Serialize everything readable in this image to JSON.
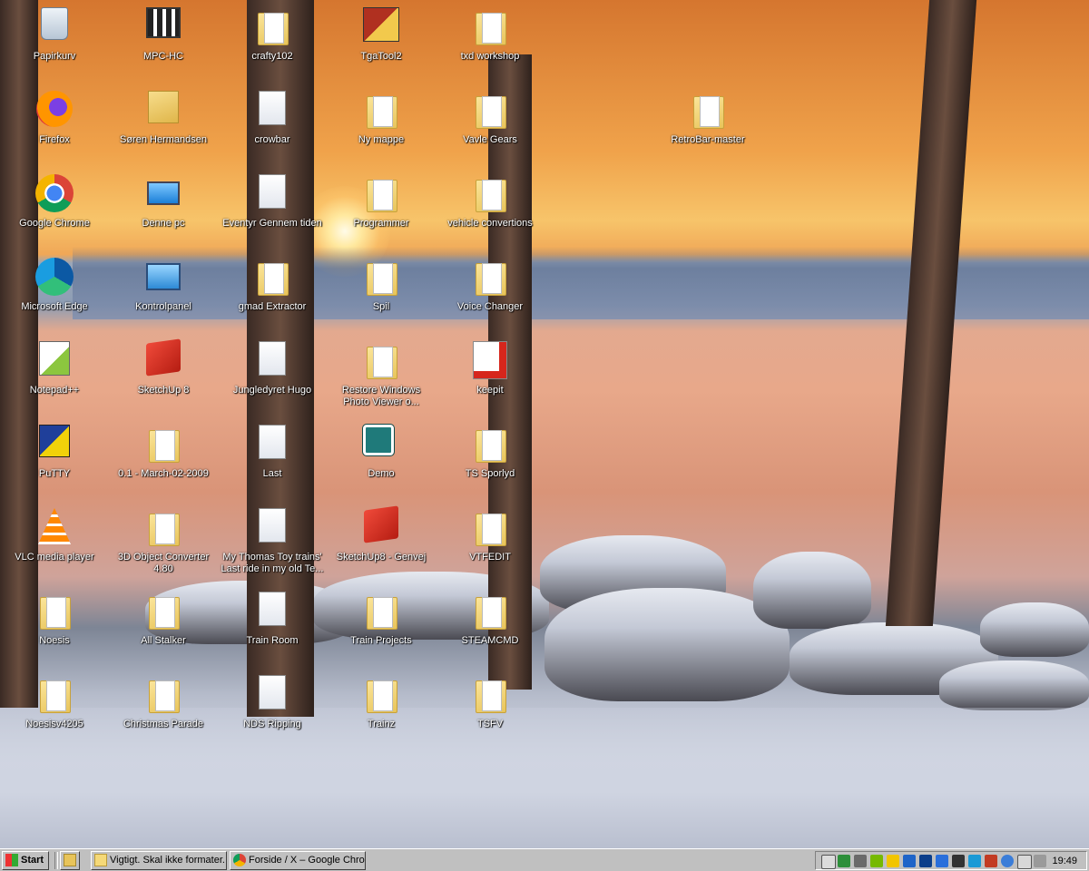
{
  "desktop": {
    "icons": [
      {
        "label": "Papirkurv",
        "icon": "recycle-bin-icon"
      },
      {
        "label": "MPC-HC",
        "icon": "mpc-hc-icon"
      },
      {
        "label": "crafty102",
        "icon": "folder-icon"
      },
      {
        "label": "TgaTool2",
        "icon": "tgatool-icon"
      },
      {
        "label": "txd workshop",
        "icon": "folder-icon"
      },
      {
        "label": "Firefox",
        "icon": "firefox-icon"
      },
      {
        "label": "Søren Hermandsen",
        "icon": "user-folder-icon"
      },
      {
        "label": "crowbar",
        "icon": "shortcut-file-icon"
      },
      {
        "label": "Ny mappe",
        "icon": "folder-icon"
      },
      {
        "label": "Vavle Gears",
        "icon": "folder-icon"
      },
      {
        "label": "RetroBar-master",
        "icon": "folder-icon"
      },
      {
        "label": "Google Chrome",
        "icon": "chrome-icon"
      },
      {
        "label": "Denne pc",
        "icon": "computer-icon"
      },
      {
        "label": "Eventyr Gennem tiden",
        "icon": "shortcut-file-icon"
      },
      {
        "label": "Programmer",
        "icon": "folder-icon"
      },
      {
        "label": "vehicle convertions",
        "icon": "folder-icon"
      },
      {
        "label": "Microsoft Edge",
        "icon": "edge-icon"
      },
      {
        "label": "Kontrolpanel",
        "icon": "control-panel-icon"
      },
      {
        "label": "gmad Extractor",
        "icon": "folder-icon"
      },
      {
        "label": "Spil",
        "icon": "folder-icon"
      },
      {
        "label": "Voice Changer",
        "icon": "folder-icon"
      },
      {
        "label": "Notepad++",
        "icon": "notepadpp-icon"
      },
      {
        "label": "SketchUp 8",
        "icon": "sketchup-icon"
      },
      {
        "label": "Jungledyret Hugo",
        "icon": "shortcut-file-icon"
      },
      {
        "label": "Restore Windows Photo Viewer o...",
        "icon": "folder-icon"
      },
      {
        "label": "keepit",
        "icon": "pdf-icon"
      },
      {
        "label": "PuTTY",
        "icon": "putty-icon"
      },
      {
        "label": "0.1 - March-02-2009",
        "icon": "folder-icon"
      },
      {
        "label": "Last",
        "icon": "shortcut-file-icon"
      },
      {
        "label": "Demo",
        "icon": "cart-app-icon"
      },
      {
        "label": "TS Sporlyd",
        "icon": "folder-icon"
      },
      {
        "label": "VLC media player",
        "icon": "vlc-icon"
      },
      {
        "label": "3D Object Converter 4.80",
        "icon": "folder-icon"
      },
      {
        "label": "My Thomas Toy trains' Last ride in my old Te...",
        "icon": "shortcut-file-icon"
      },
      {
        "label": "SketchUp8 - Genvej",
        "icon": "sketchup-icon"
      },
      {
        "label": "VTFEDIT",
        "icon": "folder-icon"
      },
      {
        "label": "Noesis",
        "icon": "folder-icon"
      },
      {
        "label": "All Stalker",
        "icon": "folder-icon"
      },
      {
        "label": "Train Room",
        "icon": "shortcut-file-icon"
      },
      {
        "label": "Train Projects",
        "icon": "folder-icon"
      },
      {
        "label": "STEAMCMD",
        "icon": "folder-icon"
      },
      {
        "label": "Noesisv4205",
        "icon": "folder-icon"
      },
      {
        "label": "Christmas Parade",
        "icon": "folder-icon"
      },
      {
        "label": "NDS Ripping",
        "icon": "shortcut-file-icon"
      },
      {
        "label": "Trainz",
        "icon": "folder-icon"
      },
      {
        "label": "TSFV",
        "icon": "folder-icon"
      }
    ]
  },
  "taskbar": {
    "start_label": "Start",
    "buttons": [
      {
        "label": "Vigtigt. Skal ikke formater...",
        "icon": "folder-icon"
      },
      {
        "label": "Forside / X – Google Chro...",
        "icon": "chrome-icon"
      }
    ],
    "clock": "19:49"
  },
  "colors": {
    "taskbar": "#c0c0c0",
    "sky_orange": "#f0a34b",
    "snow": "#cfd4e1"
  }
}
